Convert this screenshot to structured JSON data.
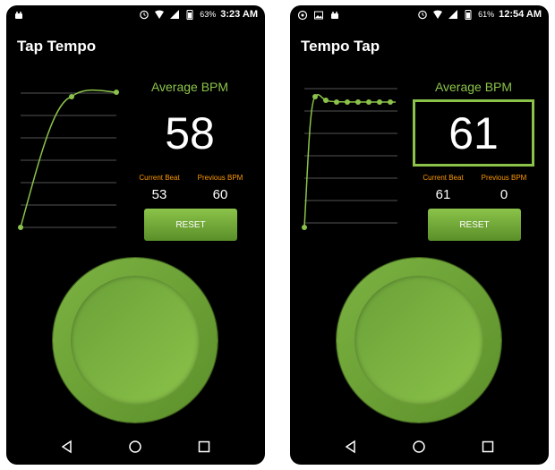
{
  "screens": [
    {
      "status": {
        "battery": "63%",
        "time": "3:23 AM"
      },
      "title": "Tap Tempo",
      "average_label": "Average BPM",
      "average_bpm": "58",
      "current_beat_label": "Current Beat",
      "current_beat": "53",
      "previous_bpm_label": "Previous BPM",
      "previous_bpm": "60",
      "reset_label": "RESET"
    },
    {
      "status": {
        "battery": "61%",
        "time": "12:54 AM"
      },
      "title": "Tempo Tap",
      "average_label": "Average BPM",
      "average_bpm": "61",
      "current_beat_label": "Current Beat",
      "current_beat": "61",
      "previous_bpm_label": "Previous BPM",
      "previous_bpm": "0",
      "reset_label": "RESET"
    }
  ],
  "colors": {
    "accent": "#8bc34a",
    "label_orange": "#ff9800",
    "background": "#000000",
    "text": "#ffffff"
  },
  "icons": {
    "status_left_screen1": [
      "android-icon"
    ],
    "status_left_screen2": [
      "whatsapp-icon",
      "image-icon",
      "android-icon"
    ],
    "status_right": [
      "alarm-icon",
      "wifi-icon",
      "signal-icon",
      "battery-icon"
    ],
    "nav": [
      "back-icon",
      "home-icon",
      "recents-icon"
    ]
  }
}
